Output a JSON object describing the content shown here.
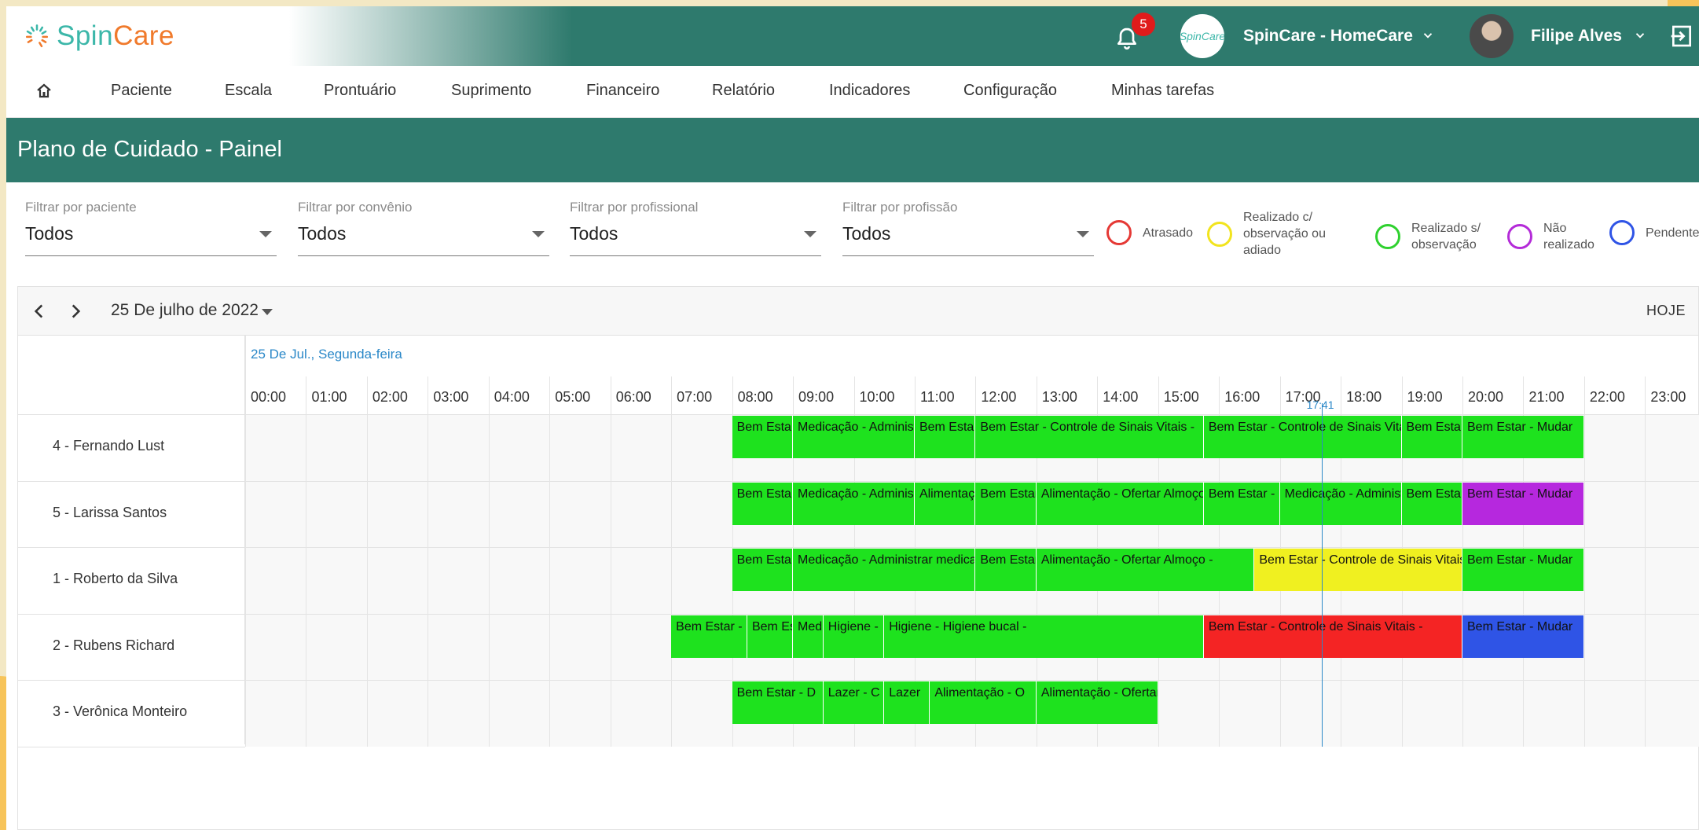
{
  "colors": {
    "brand_primary": "#2e7a6d",
    "logo_teal": "#3cb7a9",
    "logo_orange": "#f07a2c",
    "badge_red": "#e01b1b",
    "status_late": "#e53935",
    "status_done_with_note": "#f2e41e",
    "status_done": "#2fd12f",
    "status_not_done": "#b42bd8",
    "status_pending": "#2f54e6",
    "today_accent": "#2b88c8"
  },
  "header": {
    "logo_spin": "Spin",
    "logo_care": "Care",
    "notifications_count": "5",
    "company_avatar_text": "SpinCare",
    "company_name": "SpinCare - HomeCare",
    "user_name": "Filipe Alves"
  },
  "nav": {
    "items": [
      "Paciente",
      "Escala",
      "Prontuário",
      "Suprimento",
      "Financeiro",
      "Relatório",
      "Indicadores",
      "Configuração",
      "Minhas tarefas"
    ]
  },
  "page": {
    "title": "Plano de Cuidado - Painel"
  },
  "filters": [
    {
      "label": "Filtrar por paciente",
      "value": "Todos"
    },
    {
      "label": "Filtrar por convênio",
      "value": "Todos"
    },
    {
      "label": "Filtrar por profissional",
      "value": "Todos"
    },
    {
      "label": "Filtrar por profissão",
      "value": "Todos"
    }
  ],
  "legend": [
    {
      "label": "Atrasado",
      "color": "#e53935"
    },
    {
      "label": "Realizado c/ observação ou adiado",
      "color": "#f2e41e"
    },
    {
      "label": "Realizado s/ observação",
      "color": "#2fd12f"
    },
    {
      "label": "Não realizado",
      "color": "#b42bd8"
    },
    {
      "label": "Pendente",
      "color": "#2f54e6"
    }
  ],
  "calendar": {
    "date_label": "25 De julho de 2022",
    "today_label": "HOJE",
    "day_header": "25 De Jul., Segunda-feira",
    "hours": [
      "00:00",
      "01:00",
      "02:00",
      "03:00",
      "04:00",
      "05:00",
      "06:00",
      "07:00",
      "08:00",
      "09:00",
      "10:00",
      "11:00",
      "12:00",
      "13:00",
      "14:00",
      "15:00",
      "16:00",
      "17:00",
      "18:00",
      "19:00",
      "20:00",
      "21:00",
      "22:00",
      "23:00"
    ],
    "now_time": "17:41",
    "resources": [
      {
        "name": "4 - Fernando Lust",
        "events": [
          {
            "title": "Bem Estar",
            "start": "08:00",
            "end": "09:00",
            "status": "green"
          },
          {
            "title": "Medicação - Administrar",
            "start": "09:00",
            "end": "11:00",
            "status": "green"
          },
          {
            "title": "Bem Estar",
            "start": "11:00",
            "end": "12:00",
            "status": "green"
          },
          {
            "title": "Bem Estar - Controle de Sinais Vitais -",
            "start": "12:00",
            "end": "15:45",
            "status": "green"
          },
          {
            "title": "Bem Estar - Controle de Sinais Vitais -",
            "start": "15:45",
            "end": "19:00",
            "status": "green"
          },
          {
            "title": "Bem Estar",
            "start": "19:00",
            "end": "20:00",
            "status": "green"
          },
          {
            "title": "Bem Estar - Mudar",
            "start": "20:00",
            "end": "22:00",
            "status": "green"
          }
        ]
      },
      {
        "name": "5 - Larissa Santos",
        "events": [
          {
            "title": "Bem Estar",
            "start": "08:00",
            "end": "09:00",
            "status": "green"
          },
          {
            "title": "Medicação - Administrar",
            "start": "09:00",
            "end": "11:00",
            "status": "green"
          },
          {
            "title": "Alimentação",
            "start": "11:00",
            "end": "12:00",
            "status": "green"
          },
          {
            "title": "Bem Estar",
            "start": "12:00",
            "end": "13:00",
            "status": "green"
          },
          {
            "title": "Alimentação - Ofertar Almoço",
            "start": "13:00",
            "end": "15:45",
            "status": "green"
          },
          {
            "title": "Bem Estar -",
            "start": "15:45",
            "end": "17:00",
            "status": "green"
          },
          {
            "title": "Medicação - Administrar",
            "start": "17:00",
            "end": "19:00",
            "status": "green"
          },
          {
            "title": "Bem Estar",
            "start": "19:00",
            "end": "20:00",
            "status": "green"
          },
          {
            "title": "Bem Estar - Mudar",
            "start": "20:00",
            "end": "22:00",
            "status": "purple"
          }
        ]
      },
      {
        "name": "1 - Roberto da Silva",
        "events": [
          {
            "title": "Bem Estar",
            "start": "08:00",
            "end": "09:00",
            "status": "green"
          },
          {
            "title": "Medicação - Administrar medicação",
            "start": "09:00",
            "end": "12:00",
            "status": "green"
          },
          {
            "title": "Bem Estar",
            "start": "12:00",
            "end": "13:00",
            "status": "green"
          },
          {
            "title": "Alimentação - Ofertar Almoço -",
            "start": "13:00",
            "end": "16:35",
            "status": "green"
          },
          {
            "title": "Bem Estar - Controle de Sinais Vitais -",
            "start": "16:35",
            "end": "20:00",
            "status": "yellow"
          },
          {
            "title": "Bem Estar - Mudar",
            "start": "20:00",
            "end": "22:00",
            "status": "green"
          }
        ]
      },
      {
        "name": "2 - Rubens Richard",
        "events": [
          {
            "title": "Bem Estar -",
            "start": "07:00",
            "end": "08:15",
            "status": "green"
          },
          {
            "title": "Bem Estar",
            "start": "08:15",
            "end": "09:00",
            "status": "green"
          },
          {
            "title": "Medicação",
            "start": "09:00",
            "end": "09:30",
            "status": "green"
          },
          {
            "title": "Higiene -",
            "start": "09:30",
            "end": "10:30",
            "status": "green"
          },
          {
            "title": "Higiene - Higiene bucal -",
            "start": "10:30",
            "end": "15:45",
            "status": "green"
          },
          {
            "title": "Bem Estar - Controle de Sinais Vitais -",
            "start": "15:45",
            "end": "20:00",
            "status": "red"
          },
          {
            "title": "Bem Estar - Mudar",
            "start": "20:00",
            "end": "22:00",
            "status": "blue"
          }
        ]
      },
      {
        "name": "3 - Verônica Monteiro",
        "events": [
          {
            "title": "Bem Estar - D",
            "start": "08:00",
            "end": "09:30",
            "status": "green"
          },
          {
            "title": "Lazer - C",
            "start": "09:30",
            "end": "10:30",
            "status": "green"
          },
          {
            "title": "Lazer",
            "start": "10:30",
            "end": "11:15",
            "status": "green"
          },
          {
            "title": "Alimentação - O",
            "start": "11:15",
            "end": "13:00",
            "status": "green"
          },
          {
            "title": "Alimentação - Ofertar",
            "start": "13:00",
            "end": "15:00",
            "status": "green"
          }
        ]
      }
    ]
  }
}
